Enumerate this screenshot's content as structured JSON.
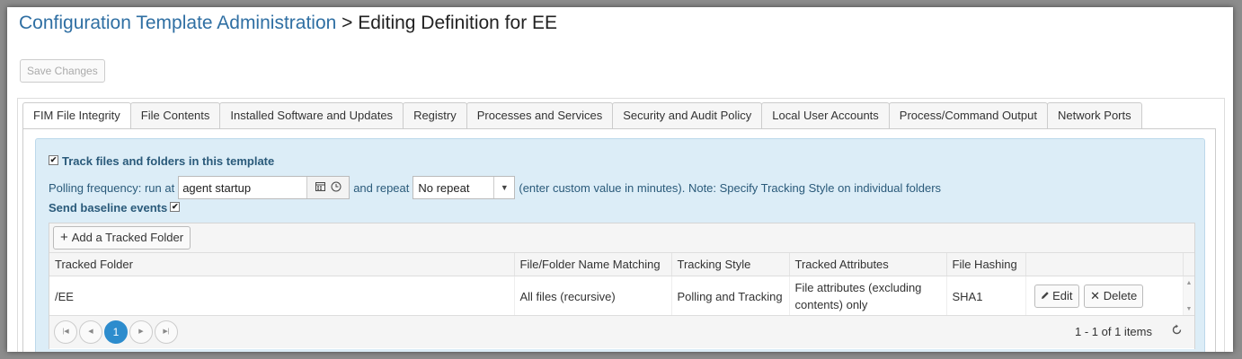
{
  "header": {
    "breadcrumb_link": "Configuration Template Administration",
    "title_rest": "> Editing Definition for EE"
  },
  "toolbar": {
    "save_label": "Save Changes"
  },
  "tabs": [
    {
      "label": "FIM File Integrity",
      "active": true
    },
    {
      "label": "File Contents"
    },
    {
      "label": "Installed Software and Updates"
    },
    {
      "label": "Registry"
    },
    {
      "label": "Processes and Services"
    },
    {
      "label": "Security and Audit Policy"
    },
    {
      "label": "Local User Accounts"
    },
    {
      "label": "Process/Command Output"
    },
    {
      "label": "Network Ports"
    }
  ],
  "fim": {
    "track_checked": true,
    "track_label": "Track files and folders in this template",
    "polling_prefix": "Polling frequency: run at",
    "run_at_value": "agent startup",
    "repeat_prefix": "and repeat",
    "repeat_value": "No repeat",
    "polling_note": "(enter custom value in minutes). Note: Specify Tracking Style on individual folders",
    "baseline_label": "Send baseline events",
    "baseline_checked": true
  },
  "grid": {
    "add_label": "Add a Tracked Folder",
    "columns": [
      "Tracked Folder",
      "File/Folder Name Matching",
      "Tracking Style",
      "Tracked Attributes",
      "File Hashing",
      ""
    ],
    "rows": [
      {
        "folder": "/EE",
        "matching": "All files (recursive)",
        "style": "Polling and Tracking",
        "attributes": "File attributes (excluding contents) only",
        "hashing": "SHA1",
        "edit_label": "Edit",
        "delete_label": "Delete"
      }
    ],
    "pager": {
      "current_page": "1",
      "info": "1 - 1 of 1 items"
    }
  },
  "colors": {
    "accent": "#2d8ccd",
    "link": "#2f6fa3",
    "panel_bg": "#dcedf7"
  }
}
